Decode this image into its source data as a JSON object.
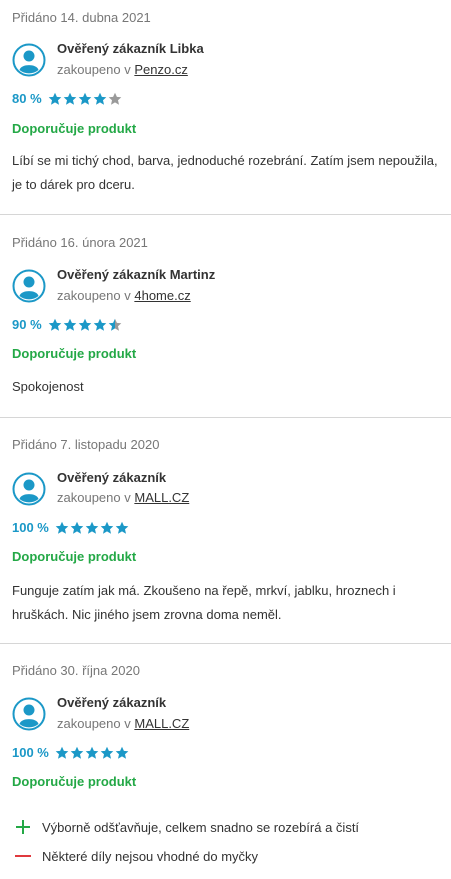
{
  "reviews": [
    {
      "date": "Přidáno 14. dubna 2021",
      "name": "Ověřený zákazník Libka",
      "store_prefix": "zakoupeno v",
      "store": "Penzo.cz",
      "rating_percent": "80 %",
      "stars": 4,
      "recommend": "Doporučuje produkt",
      "text": "Líbí se mi tichý chod, barva, jednoduché rozebrání. Zatím jsem nepoužila, je to dárek pro dceru."
    },
    {
      "date": "Přidáno 16. února 2021",
      "name": "Ověřený zákazník Martinz",
      "store_prefix": "zakoupeno v",
      "store": "4home.cz",
      "rating_percent": "90 %",
      "stars": 4.5,
      "recommend": "Doporučuje produkt",
      "text": "Spokojenost"
    },
    {
      "date": "Přidáno 7. listopadu 2020",
      "name": "Ověřený zákazník",
      "store_prefix": "zakoupeno v",
      "store": "MALL.CZ",
      "rating_percent": "100 %",
      "stars": 5,
      "recommend": "Doporučuje produkt",
      "text": "Funguje zatím jak má. Zkoušeno na řepě, mrkví, jablku, hroznech i hruškách. Nic jiného jsem zrovna doma neměl."
    },
    {
      "date": "Přidáno 30. října 2020",
      "name": "Ověřený zákazník",
      "store_prefix": "zakoupeno v",
      "store": "MALL.CZ",
      "rating_percent": "100 %",
      "stars": 5,
      "recommend": "Doporučuje produkt",
      "pros": [
        "Výborně odšťavňuje, celkem snadno se rozebírá a čistí"
      ],
      "cons": [
        "Některé díly nejsou vhodné do myčky"
      ]
    }
  ],
  "colors": {
    "accent_blue": "#1b98c7",
    "recommend_green": "#23a846",
    "star_empty": "#9a9a9a",
    "con_red": "#e0393e"
  }
}
